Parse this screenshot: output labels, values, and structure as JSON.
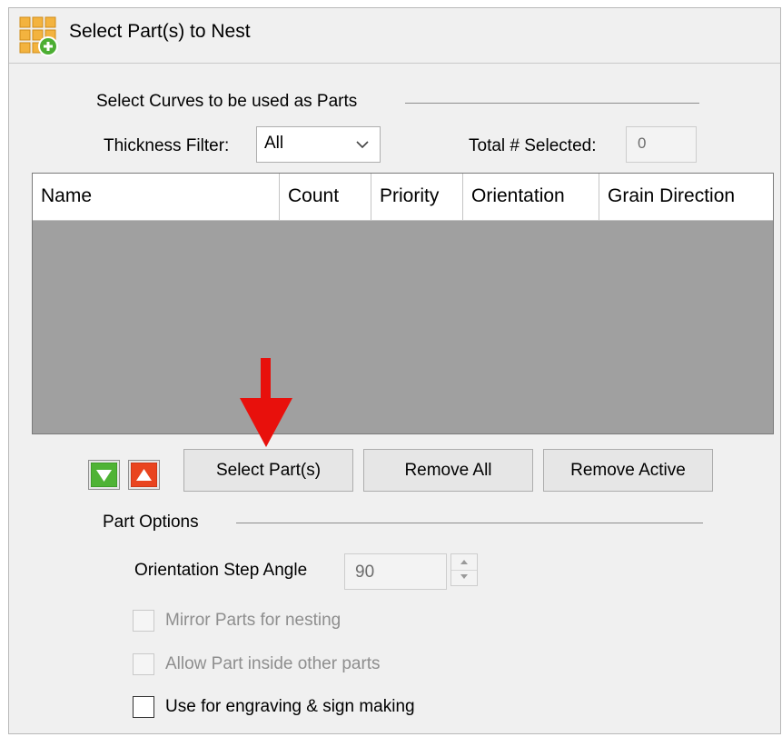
{
  "window": {
    "title": "Select Part(s) to Nest",
    "icon": "nest-grid-add-icon"
  },
  "curves_section": {
    "title": "Select Curves to be used as Parts",
    "thickness_filter_label": "Thickness Filter:",
    "thickness_filter_value": "All",
    "total_selected_label": "Total # Selected:",
    "total_selected_value": "0"
  },
  "parts_table": {
    "columns": [
      "Name",
      "Count",
      "Priority",
      "Orientation",
      "Grain Direction"
    ],
    "rows": []
  },
  "actions": {
    "move_down_icon": "green-down-triangle-icon",
    "move_up_icon": "red-up-triangle-icon",
    "select_parts_label": "Select Part(s)",
    "remove_all_label": "Remove All",
    "remove_active_label": "Remove Active"
  },
  "part_options": {
    "title": "Part Options",
    "orientation_step_label": "Orientation Step Angle",
    "orientation_step_value": "90",
    "mirror_parts_label": "Mirror Parts for nesting",
    "mirror_parts_checked": false,
    "mirror_parts_enabled": false,
    "allow_inside_label": "Allow Part inside other parts",
    "allow_inside_checked": false,
    "allow_inside_enabled": false,
    "engraving_label": "Use for engraving & sign making",
    "engraving_checked": false,
    "engraving_enabled": true
  },
  "colors": {
    "table_background": "#a0a0a0",
    "panel_background": "#f0f0f0",
    "pointer_arrow": "#e8100c"
  }
}
